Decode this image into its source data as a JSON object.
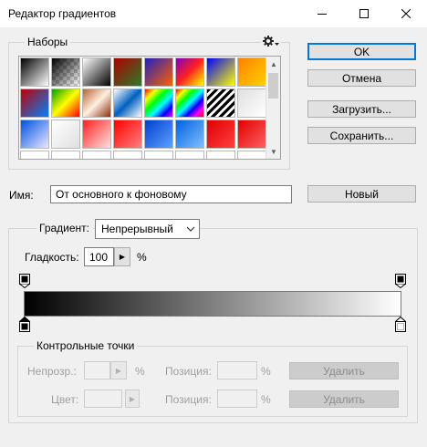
{
  "window": {
    "title": "Редактор градиентов"
  },
  "presets": {
    "label": "Наборы",
    "gear_icon": "gear-icon",
    "swatches": [
      "linear-gradient(135deg,#000 0%,#fff 100%)",
      "linear-gradient(135deg,#000 0%,rgba(0,0,0,0) 100%)",
      "linear-gradient(135deg,#fff 0%,#000 100%)",
      "linear-gradient(135deg,#b00000 0%,#2a7a2a 100%)",
      "linear-gradient(135deg,#2020c0 0%,#ff6000 100%)",
      "linear-gradient(135deg,#8000c0 0%,#ff2020 50%,#ffff00 100%)",
      "linear-gradient(135deg,#0000ff 0%,#ffff00 100%)",
      "linear-gradient(135deg,#ff8000 0%,#ffd000 100%)",
      "linear-gradient(135deg,#c00000 0%,#0080ff 100%)",
      "linear-gradient(135deg,#00a000 0%,#ffff00 50%,#ff0000 100%)",
      "linear-gradient(135deg,#c06030 0%,#fff0e0 50%,#8a3010 100%)",
      "linear-gradient(135deg,#ffffff 0%,#0060c0 50%,#ffffff 100%)",
      "linear-gradient(135deg,#ff0000,#ffff00,#00ff00,#00ffff,#0000ff,#ff00ff)",
      "linear-gradient(135deg,#ff0000,#ffff00,#00ff00,#00ffff,#0000ff,#ff00ff,#ff0000)",
      "repeating-linear-gradient(135deg,#000 0 3px,#fff 3px 6px)",
      "linear-gradient(135deg,#e0e0e0 0%,#ffffff 100%)",
      "linear-gradient(135deg,#0050e0 0%,#e8e8ff 100%)",
      "linear-gradient(135deg,#ffffff 0%,#e0e0e0 100%)",
      "linear-gradient(135deg,#ff2020 0%,#ffe0e0 100%)",
      "linear-gradient(135deg,#ff0000 0%,#ff8080 100%)",
      "linear-gradient(135deg,#0040d0 0%,#60a0ff 100%)",
      "linear-gradient(135deg,#0060e0 0%,#80c0ff 100%)",
      "linear-gradient(135deg,#e00000 0%,#ff4040 100%)",
      "linear-gradient(135deg,#e00000 0%,#ff6060 100%)",
      "#e01010",
      "#e01010",
      "#e01010",
      "#e01010",
      "#e01010",
      "#e01010",
      "#e01010",
      "#e01010"
    ]
  },
  "buttons": {
    "ok": "OK",
    "cancel": "Отмена",
    "load": "Загрузить...",
    "save": "Сохранить...",
    "new": "Новый"
  },
  "name_field": {
    "label": "Имя:",
    "value": "От основного к фоновому"
  },
  "gradient": {
    "type_label": "Градиент:",
    "type_value": "Непрерывный",
    "smoothness_label": "Гладкость:",
    "smoothness_value": "100",
    "smoothness_unit": "%",
    "start_color": "#000000",
    "end_color": "#ffffff"
  },
  "stops": {
    "group_label": "Контрольные точки",
    "opacity_label": "Непрозр.:",
    "opacity_unit": "%",
    "color_label": "Цвет:",
    "position_label": "Позиция:",
    "position_unit": "%",
    "delete_label": "Удалить"
  }
}
